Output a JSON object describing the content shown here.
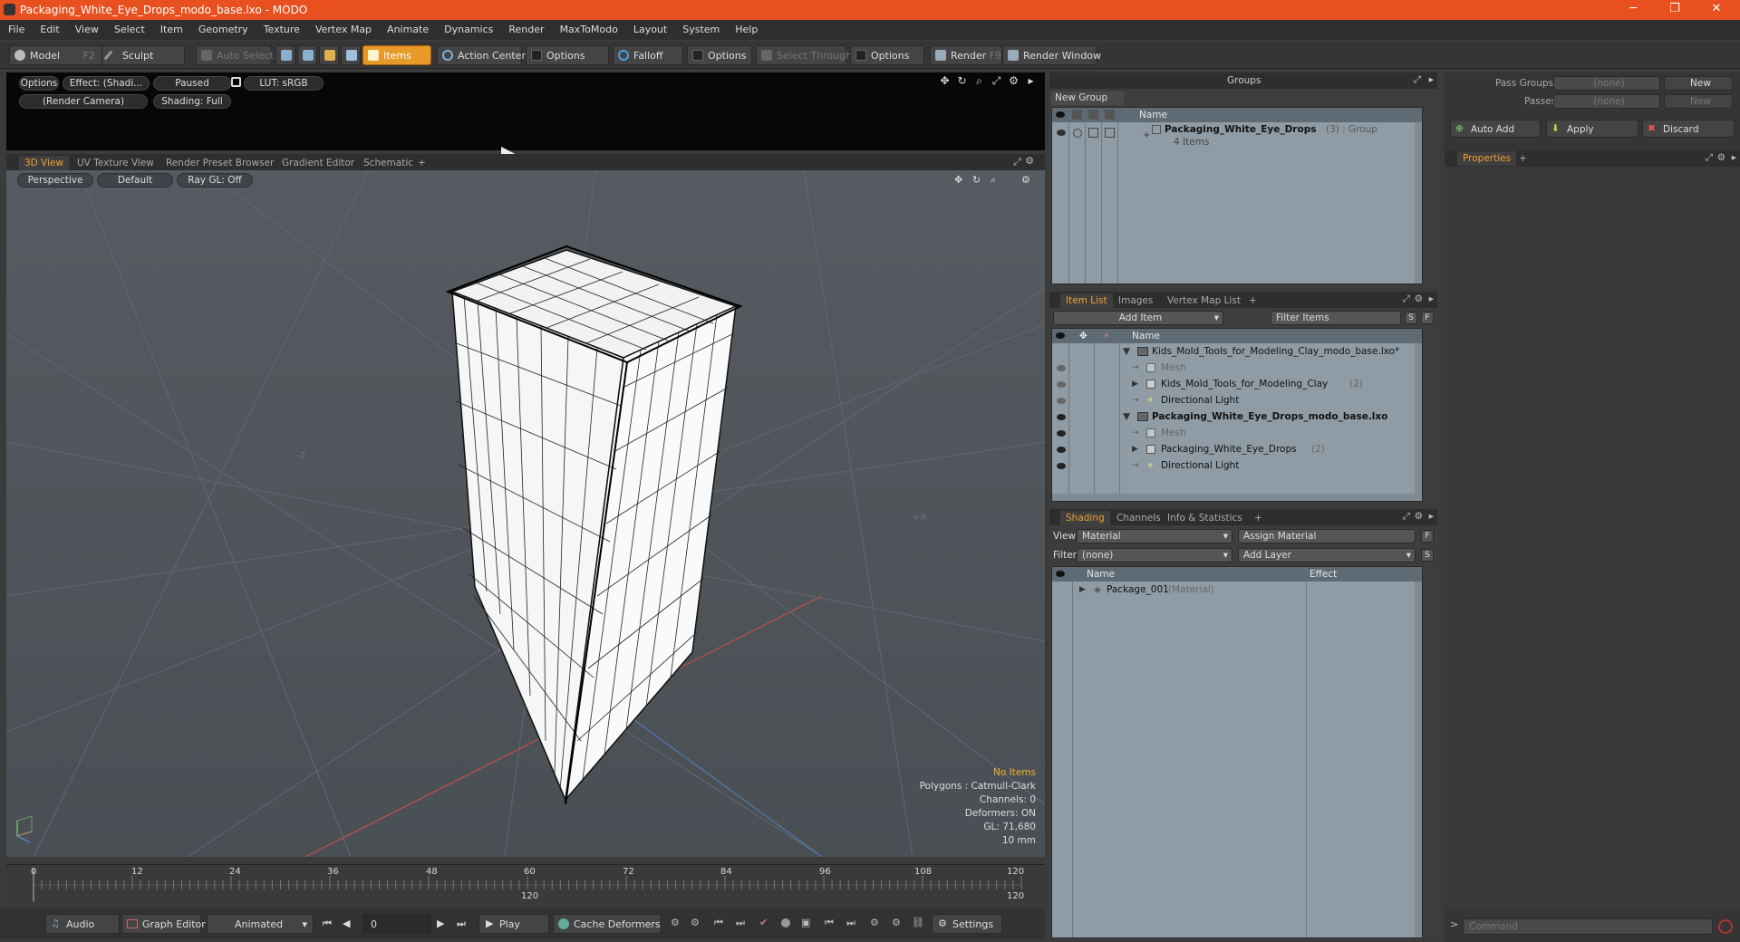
{
  "window": {
    "title": "Packaging_White_Eye_Drops_modo_base.lxo - MODO",
    "min": "─",
    "max": "❐",
    "close": "✕"
  },
  "menu": [
    "File",
    "Edit",
    "View",
    "Select",
    "Item",
    "Geometry",
    "Texture",
    "Vertex Map",
    "Animate",
    "Dynamics",
    "Render",
    "MaxToModo",
    "Layout",
    "System",
    "Help"
  ],
  "toolbar": {
    "model": "Model",
    "model_key": "F2",
    "sculpt": "Sculpt",
    "auto_select": "Auto Select",
    "items": "Items",
    "action_center": "Action Center",
    "options1": "Options",
    "falloff": "Falloff",
    "options2": "Options",
    "select_through": "Select Through",
    "options3": "Options",
    "render": "Render",
    "render_key": "F9",
    "render_window": "Render Window"
  },
  "preview": {
    "options": "Options",
    "effect": "Effect: (Shadi...",
    "paused": "Paused",
    "lut": "LUT: sRGB",
    "camera": "(Render Camera)",
    "shading": "Shading: Full"
  },
  "viewport_tabs": [
    "3D View",
    "UV Texture View",
    "Render Preset Browser",
    "Gradient Editor",
    "Schematic",
    "+"
  ],
  "viewport": {
    "perspective": "Perspective",
    "default": "Default",
    "raygl": "Ray GL: Off",
    "axis_z": "-Z",
    "axis_x": "+X"
  },
  "hud": {
    "no_items": "No Items",
    "polygons": "Polygons : Catmull-Clark",
    "channels": "Channels: 0",
    "deformers": "Deformers: ON",
    "gl": "GL: 71,680",
    "unit": "10 mm"
  },
  "timeline": {
    "ticks": [
      "0",
      "12",
      "24",
      "36",
      "48",
      "60",
      "72",
      "84",
      "96",
      "108",
      "120"
    ],
    "end_mid": "120",
    "end_right": "120"
  },
  "bottombar": {
    "audio": "Audio",
    "graph_editor": "Graph Editor",
    "animated": "Animated",
    "frame": "0",
    "play": "Play",
    "cache": "Cache Deformers",
    "settings": "Settings"
  },
  "groups": {
    "title": "Groups",
    "new_group": "New Group",
    "col_name": "Name",
    "item_name": "Packaging_White_Eye_Drops",
    "item_count": "(3)",
    "item_type": ": Group",
    "item_sub": "4 Items"
  },
  "right_top": {
    "pass_groups": "Pass Groups",
    "passes": "Passes",
    "none1": "(none)",
    "none2": "(none)",
    "new1": "New",
    "new2": "New",
    "auto_add": "Auto Add",
    "apply": "Apply",
    "discard": "Discard",
    "properties": "Properties",
    "plus": "+"
  },
  "itemlist": {
    "tabs": [
      "Item List",
      "Images",
      "Vertex Map List",
      "+"
    ],
    "add_item": "Add Item",
    "filter_items": "Filter Items",
    "s": "S",
    "f": "F",
    "col_name": "Name",
    "rows": [
      {
        "label": "Kids_Mold_Tools_for_Modeling_Clay_modo_base.lxo*",
        "extra": "",
        "bold": false
      },
      {
        "label": "Mesh",
        "extra": "",
        "bold": false
      },
      {
        "label": "Kids_Mold_Tools_for_Modeling_Clay",
        "extra": "(2)",
        "bold": false
      },
      {
        "label": "Directional Light",
        "extra": "",
        "bold": false
      },
      {
        "label": "Packaging_White_Eye_Drops_modo_base.lxo",
        "extra": "",
        "bold": true
      },
      {
        "label": "Mesh",
        "extra": "",
        "bold": false
      },
      {
        "label": "Packaging_White_Eye_Drops",
        "extra": "(2)",
        "bold": false
      },
      {
        "label": "Directional Light",
        "extra": "",
        "bold": false
      }
    ]
  },
  "shading": {
    "tabs": [
      "Shading",
      "Channels",
      "Info & Statistics",
      "+"
    ],
    "view_label": "View",
    "view_value": "Material",
    "assign_material": "Assign Material",
    "f": "F",
    "filter_label": "Filter",
    "filter_value": "(none)",
    "add_layer": "Add Layer",
    "s": "S",
    "col_name": "Name",
    "col_effect": "Effect",
    "row_name": "Package_001",
    "row_type": "(Material)"
  },
  "command": {
    "placeholder": "Command"
  }
}
